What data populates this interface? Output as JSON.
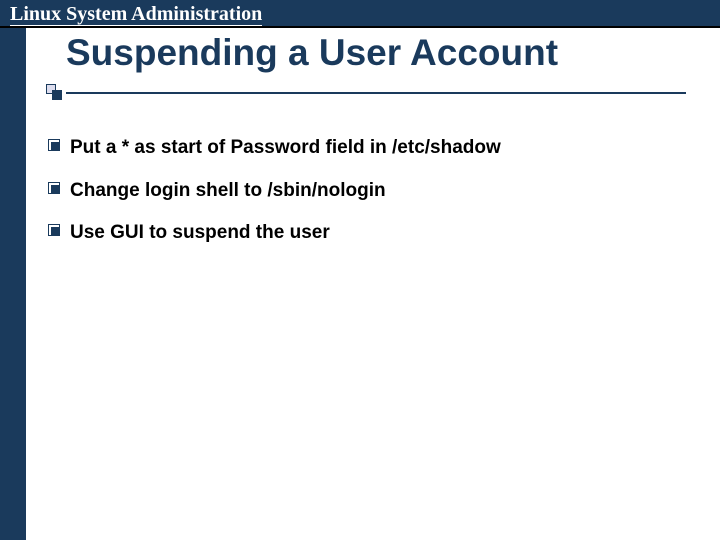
{
  "header": {
    "title": "Linux System Administration"
  },
  "slide": {
    "title": "Suspending a User Account",
    "bullets": [
      "Put a * as start of Password field in /etc/shadow",
      "Change login shell to /sbin/nologin",
      "Use GUI to suspend the user"
    ]
  },
  "colors": {
    "brand": "#1a3a5c"
  }
}
